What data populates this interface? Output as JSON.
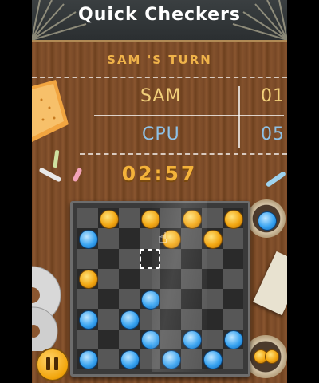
{
  "title": "Quick Checkers",
  "turn_text": "SAM 'S TURN",
  "scoreboard": {
    "player1": {
      "name": "SAM",
      "score": "01"
    },
    "player2": {
      "name": "CPU",
      "score": "05"
    }
  },
  "timer": "02:57",
  "board": {
    "rows": 8,
    "cols": 8,
    "gold_pieces": [
      [
        0,
        1
      ],
      [
        0,
        3
      ],
      [
        0,
        5
      ],
      [
        0,
        7
      ],
      [
        1,
        4
      ],
      [
        1,
        6
      ],
      [
        3,
        0
      ]
    ],
    "blue_pieces": [
      [
        1,
        0
      ],
      [
        4,
        3
      ],
      [
        5,
        0
      ],
      [
        5,
        2
      ],
      [
        6,
        3
      ],
      [
        6,
        5
      ],
      [
        6,
        7
      ],
      [
        7,
        0
      ],
      [
        7,
        2
      ],
      [
        7,
        4
      ],
      [
        7,
        6
      ]
    ],
    "selected_square": [
      2,
      3
    ]
  },
  "colors": {
    "gold_piece": "#f3a712",
    "blue_piece": "#37a3f1",
    "turn_text": "#f0b34a",
    "player1_text": "#f2d07a",
    "player2_text": "#8ec1e6"
  },
  "icons": {
    "pause": "pause-icon",
    "cursor": "hand-pointer-icon"
  }
}
